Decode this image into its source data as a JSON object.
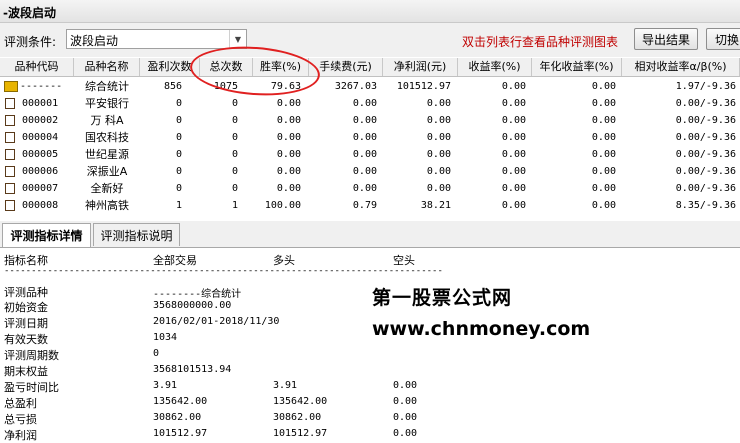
{
  "window": {
    "title": "-波段启动"
  },
  "toolbar": {
    "condition_label": "评测条件:",
    "condition_value": "波段启动",
    "hint": "双击列表行查看品种评测图表",
    "export_label": "导出结果",
    "switch_label": "切换"
  },
  "table": {
    "headers": [
      "品种代码",
      "品种名称",
      "盈利次数",
      "总次数",
      "胜率(%)",
      "手续费(元)",
      "净利润(元)",
      "收益率(%)",
      "年化收益率(%)",
      "相对收益率α/β(%)"
    ],
    "rows": [
      {
        "code": "-------",
        "name": "综合统计",
        "profit": "856",
        "total": "1075",
        "win": "79.63",
        "fee": "3267.03",
        "net": "101512.97",
        "ret": "0.00",
        "annual": "0.00",
        "rel": "1.97/-9.36"
      },
      {
        "code": "000001",
        "name": "平安银行",
        "profit": "0",
        "total": "0",
        "win": "0.00",
        "fee": "0.00",
        "net": "0.00",
        "ret": "0.00",
        "annual": "0.00",
        "rel": "0.00/-9.36"
      },
      {
        "code": "000002",
        "name": "万 科A",
        "profit": "0",
        "total": "0",
        "win": "0.00",
        "fee": "0.00",
        "net": "0.00",
        "ret": "0.00",
        "annual": "0.00",
        "rel": "0.00/-9.36"
      },
      {
        "code": "000004",
        "name": "国农科技",
        "profit": "0",
        "total": "0",
        "win": "0.00",
        "fee": "0.00",
        "net": "0.00",
        "ret": "0.00",
        "annual": "0.00",
        "rel": "0.00/-9.36"
      },
      {
        "code": "000005",
        "name": "世纪星源",
        "profit": "0",
        "total": "0",
        "win": "0.00",
        "fee": "0.00",
        "net": "0.00",
        "ret": "0.00",
        "annual": "0.00",
        "rel": "0.00/-9.36"
      },
      {
        "code": "000006",
        "name": "深振业A",
        "profit": "0",
        "total": "0",
        "win": "0.00",
        "fee": "0.00",
        "net": "0.00",
        "ret": "0.00",
        "annual": "0.00",
        "rel": "0.00/-9.36"
      },
      {
        "code": "000007",
        "name": "全新好",
        "profit": "0",
        "total": "0",
        "win": "0.00",
        "fee": "0.00",
        "net": "0.00",
        "ret": "0.00",
        "annual": "0.00",
        "rel": "0.00/-9.36"
      },
      {
        "code": "000008",
        "name": "神州高铁",
        "profit": "1",
        "total": "1",
        "win": "100.00",
        "fee": "0.79",
        "net": "38.21",
        "ret": "0.00",
        "annual": "0.00",
        "rel": "8.35/-9.36"
      }
    ]
  },
  "tabs": [
    "评测指标详情",
    "评测指标说明"
  ],
  "detail": {
    "headers": [
      "指标名称",
      "全部交易",
      "多头",
      "空头"
    ],
    "divider": "------------------------------------------------------------------------------------------------",
    "rows": [
      {
        "name": "评测品种",
        "all": "--------综合统计",
        "long": "",
        "short": ""
      },
      {
        "name": "初始资金",
        "all": "3568000000.00",
        "long": "",
        "short": ""
      },
      {
        "name": "评测日期",
        "all": "2016/02/01-2018/11/30",
        "long": "",
        "short": ""
      },
      {
        "name": "有效天数",
        "all": "1034",
        "long": "",
        "short": ""
      },
      {
        "name": "评测周期数",
        "all": "0",
        "long": "",
        "short": ""
      },
      {
        "name": "期末权益",
        "all": "3568101513.94",
        "long": "",
        "short": ""
      },
      {
        "name": "盈亏时间比",
        "all": "3.91",
        "long": "3.91",
        "short": "0.00"
      },
      {
        "name": "总盈利",
        "all": "135642.00",
        "long": "135642.00",
        "short": "0.00"
      },
      {
        "name": "总亏损",
        "all": "30862.00",
        "long": "30862.00",
        "short": "0.00"
      },
      {
        "name": "净利润",
        "all": "101512.97",
        "long": "101512.97",
        "short": "0.00"
      }
    ]
  },
  "watermark": {
    "line1": "第一股票公式网",
    "line2": "www.chnmoney.com"
  },
  "colors": {
    "hint": "#c00000",
    "annotation_circle": "#e02020"
  }
}
